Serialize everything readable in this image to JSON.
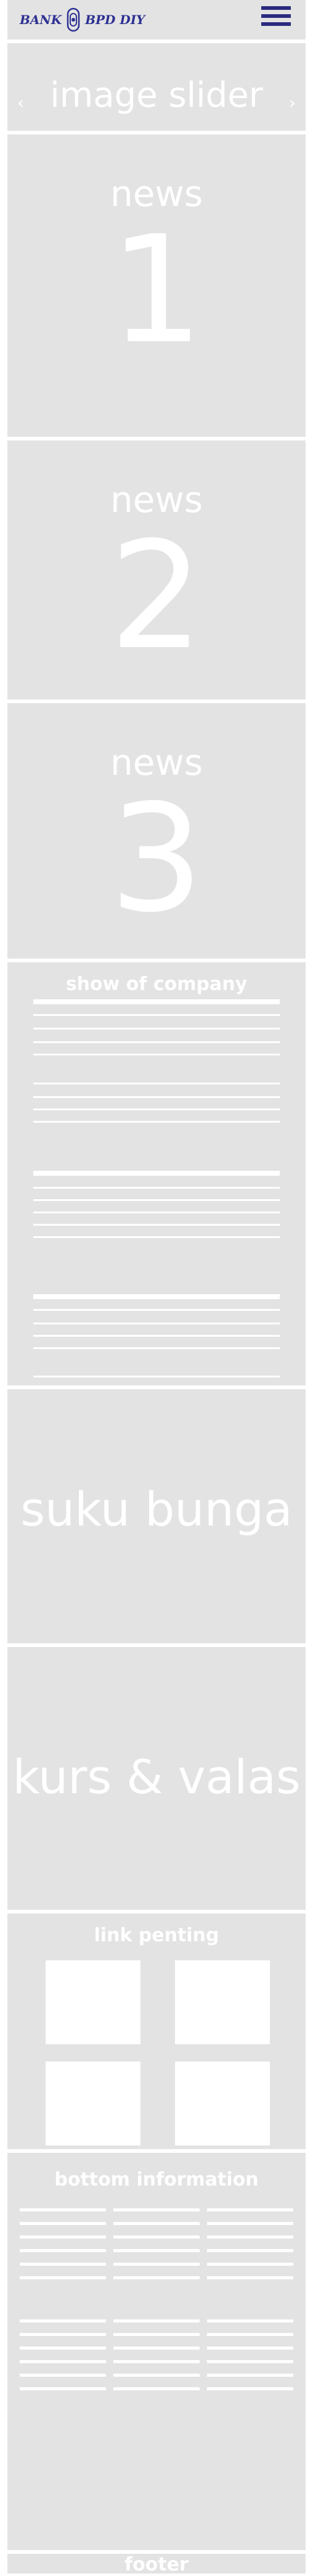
{
  "header": {
    "logo_left": "BANK",
    "logo_right": "BPD DIY",
    "menu_icon": "hamburger-menu-icon",
    "brand_color": "#2e3192"
  },
  "slider": {
    "title": "image slider",
    "prev": "‹",
    "next": "›"
  },
  "news": [
    {
      "label": "news",
      "number": "1"
    },
    {
      "label": "news",
      "number": "2"
    },
    {
      "label": "news",
      "number": "3"
    }
  ],
  "company": {
    "title": "show of company"
  },
  "suku_bunga": {
    "title": "suku bunga"
  },
  "kurs": {
    "title": "kurs & valas"
  },
  "links": {
    "title": "link penting"
  },
  "bottom": {
    "title": "bottom information"
  },
  "footer": {
    "label": "footer"
  },
  "colors": {
    "panel": "#e3e3e3",
    "text": "#ffffff"
  }
}
